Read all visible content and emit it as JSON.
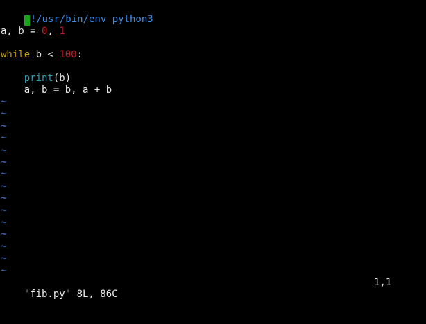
{
  "colors": {
    "background": "#000000",
    "default_text": "#e8e8e8",
    "shebang": "#3b8eea",
    "number": "#c01c28",
    "keyword": "#c4a000",
    "function": "#2aa1b3",
    "tilde": "#3465a4",
    "cursor": "#19a319"
  },
  "editor": {
    "shebang_char": "#",
    "shebang": "!/usr/bin/env python3",
    "line2": {
      "vars": "a, b = ",
      "n0": "0",
      "sep": ", ",
      "n1": "1"
    },
    "line4": {
      "keyword": "while",
      "cond": " b < ",
      "num": "100",
      "colon": ":"
    },
    "line6": {
      "indent": "    ",
      "func": "print",
      "args": "(b)"
    },
    "line7": "    a, b = b, a + b",
    "tilde": "~"
  },
  "status": {
    "message": "\"fib.py\" 8L, 86C",
    "position": "1,1"
  }
}
